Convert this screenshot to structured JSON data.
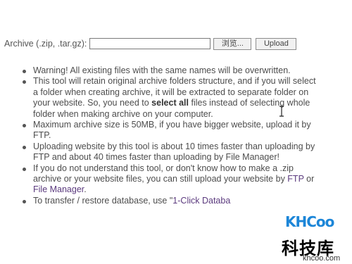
{
  "upload": {
    "label": "Archive (.zip, .tar.gz):",
    "file_value": "",
    "browse_label": "浏览...",
    "upload_label": "Upload"
  },
  "notes": [
    {
      "lines": [
        "Warning! All existing files with the same names will be overwritten."
      ]
    },
    {
      "lines_parts": true
    },
    {
      "lines": [
        "Maximum archive size is 50MB, if you have bigger website, upload it by",
        "FTP."
      ]
    },
    {
      "lines": [
        "Uploading website by this tool is about 10 times faster than uploading by",
        "FTP and about 40 times faster than uploading by File Manager!"
      ]
    }
  ],
  "note2": {
    "l1": "This tool will retain original archive folders structure, and if you will select",
    "l2": "a folder when creating archive, it will be extracted to separate folder on",
    "l3a": "your website. So, you need to ",
    "l3b": "select all",
    "l3c": " files instead of selecting whole",
    "l4": "folder when making archive on your computer."
  },
  "note5": {
    "l1": "If you do not understand this tool, or don't know how to make a .zip",
    "l2a": "archive or your website files, you can still upload your website by ",
    "l2b": "FTP",
    "l2c": " or",
    "l3": "File Manager",
    "l3b": "."
  },
  "note6": {
    "a": "To transfer / restore database, use \"",
    "b": "1-Click Databa"
  },
  "watermark": {
    "logo": "KHCoo",
    "chinese": "科技库",
    "site": "khcoo.com"
  }
}
